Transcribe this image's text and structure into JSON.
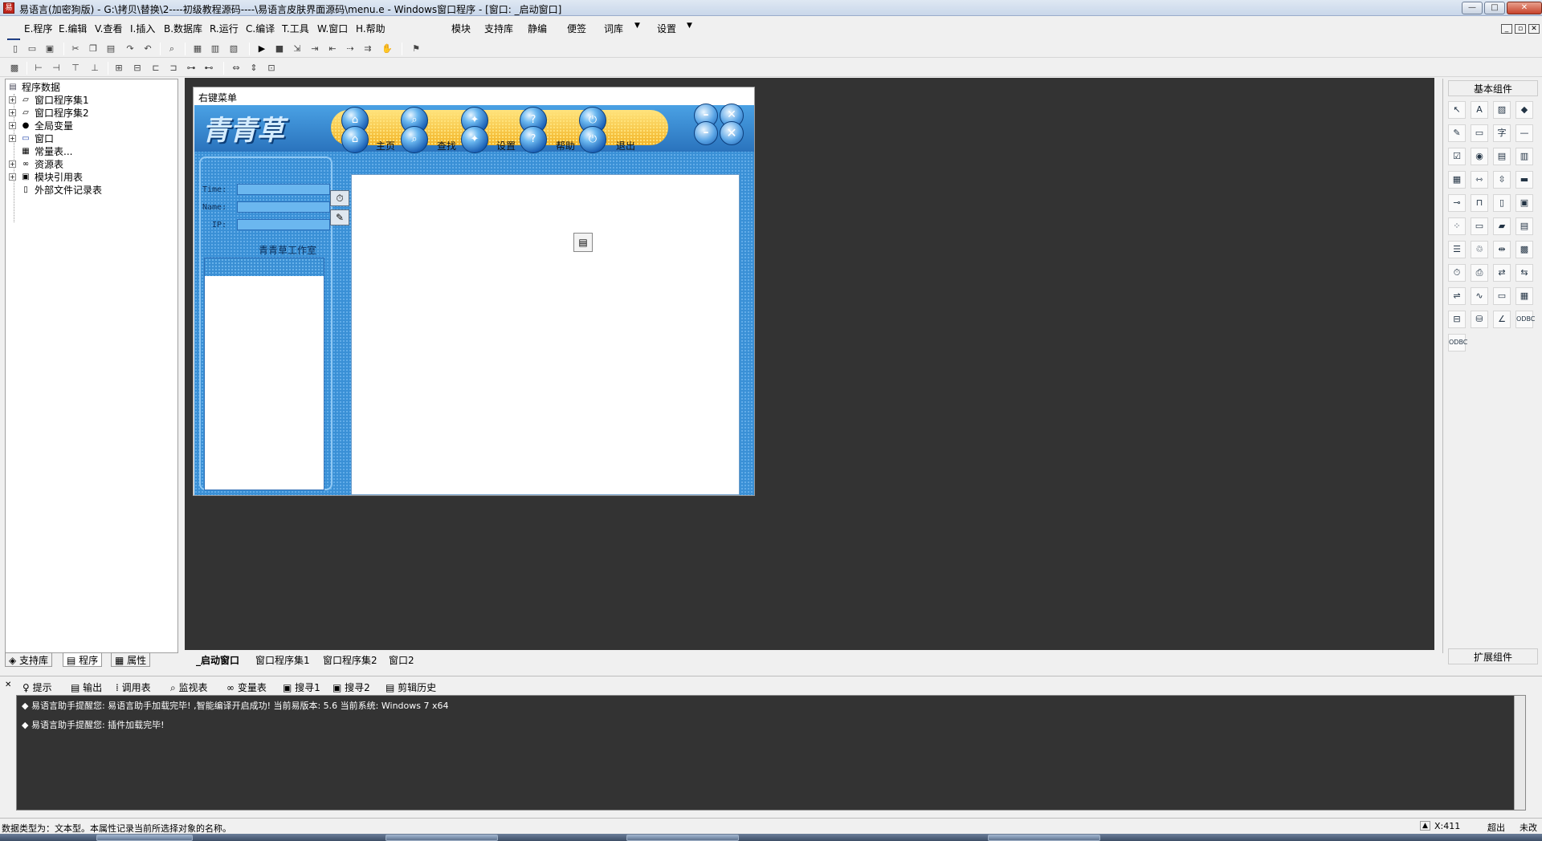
{
  "window": {
    "title": "易语言(加密狗版) - G:\\拷贝\\替换\\2----初级教程源码----\\易语言皮肤界面源码\\menu.e - Windows窗口程序 - [窗口: _启动窗口]",
    "min_label": "—",
    "max_label": "□",
    "close_label": "✕"
  },
  "menubar": {
    "items": [
      "E.程序",
      "E.编辑",
      "V.查看",
      "I.插入",
      "B.数据库",
      "R.运行",
      "C.编译",
      "T.工具",
      "W.窗口",
      "H.帮助",
      "模块",
      "支持库",
      "静编",
      "便签",
      "词库",
      "设置"
    ],
    "mdi_min": "_",
    "mdi_restore": "▫",
    "mdi_close": "✕"
  },
  "left_panel": {
    "tree": [
      "程序数据",
      "窗口程序集1",
      "窗口程序集2",
      "全局变量",
      "窗口",
      "常量表...",
      "资源表",
      "模块引用表",
      "外部文件记录表"
    ],
    "tabs": [
      "支持库",
      "程序",
      "属性"
    ]
  },
  "design_window": {
    "title": "右键菜单",
    "brand": "青青草",
    "nav": [
      "主页",
      "查找",
      "设置",
      "帮助",
      "退出"
    ],
    "fields": [
      "Time:",
      "Name:",
      "IP:"
    ],
    "group_label": "青青草工作室QQ"
  },
  "doc_tabs": [
    "_启动窗口",
    "窗口程序集1",
    "窗口程序集2",
    "窗口2"
  ],
  "right_panel": {
    "title": "基本组件",
    "footer": "扩展组件"
  },
  "bottom_tabs": [
    "提示",
    "输出",
    "调用表",
    "监视表",
    "变量表",
    "搜寻1",
    "搜寻2",
    "剪辑历史"
  ],
  "output": {
    "lines": [
      "易语言助手提醒您: 易语言助手加载完毕! ,智能编译开启成功! 当前易版本: 5.6 当前系统: Windows 7 x64",
      "易语言助手提醒您: 插件加载完毕!"
    ]
  },
  "status": {
    "text": "数据类型为：文本型。本属性记录当前所选择对象的名称。",
    "coord": "X:411",
    "mode1": "超出",
    "mode2": "未改"
  }
}
